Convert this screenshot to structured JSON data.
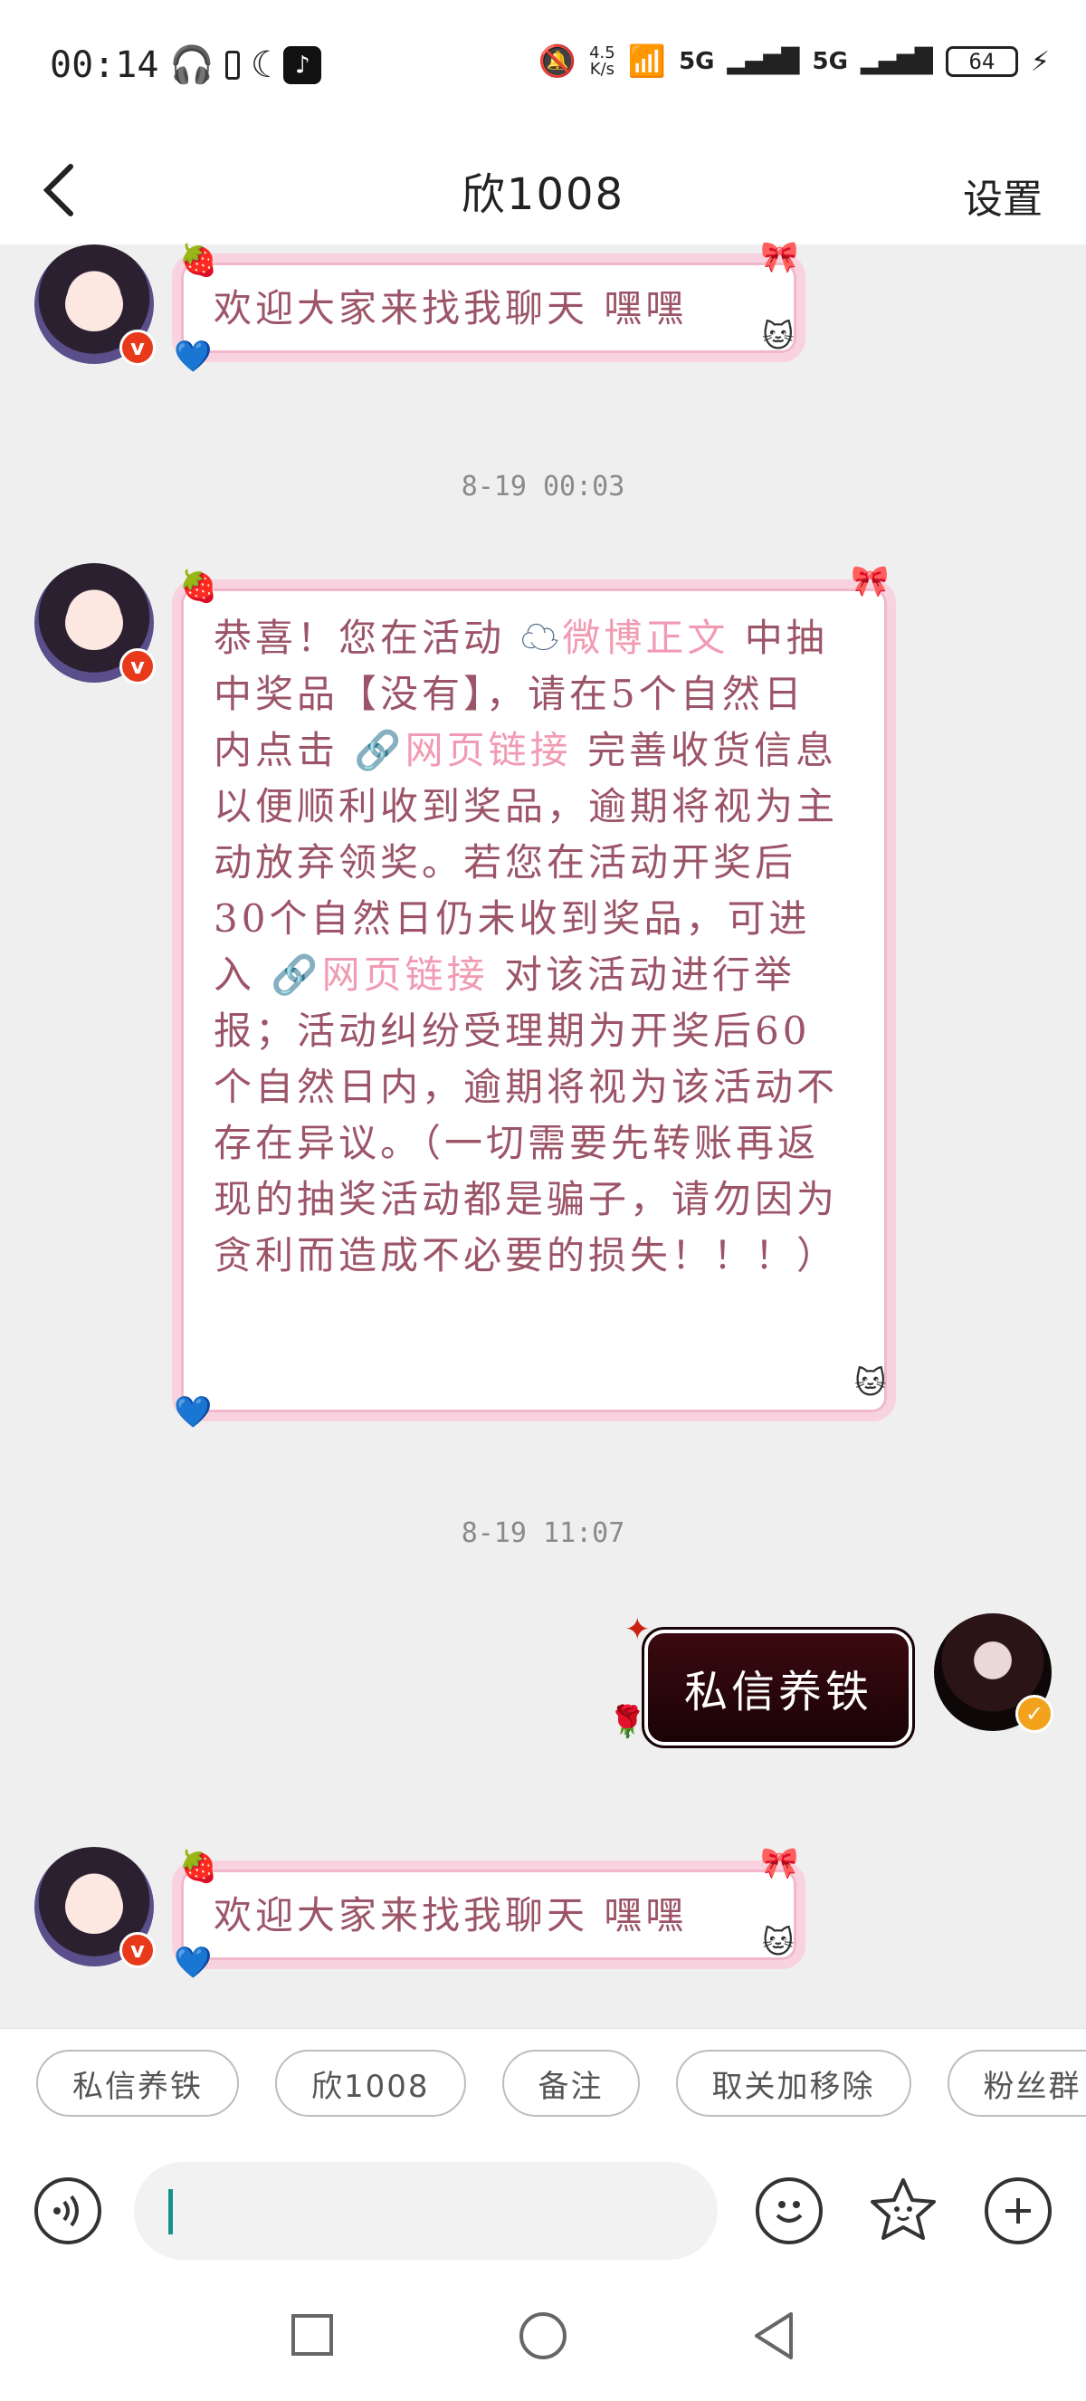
{
  "status": {
    "time": "00:14",
    "net_speed_value": "4.5",
    "net_speed_unit": "K/s",
    "signal1": "5G",
    "signal2": "5G",
    "battery": "64"
  },
  "nav": {
    "title": "欣1008",
    "settings_label": "设置"
  },
  "messages": [
    {
      "text": "欢迎大家来找我聊天 嘿嘿"
    },
    {
      "timestamp": "8-19 00:03",
      "parts": {
        "p1": "恭喜！您在活动",
        "link1": "微博正文",
        "p2": "中抽中奖品【没有】，请在5个自然日内点击",
        "link2": "网页链接",
        "p3": "完善收货信息以便顺利收到奖品，逾期将视为主动放弃领奖。若您在活动开奖后30个自然日仍未收到奖品，可进入",
        "link3": "网页链接",
        "p4": "对该活动进行举报；活动纠纷受理期为开奖后60个自然日内，逾期将视为该活动不存在异议。（一切需要先转账再返现的抽奖活动都是骗子，请勿因为贪利而造成不必要的损失！！！）"
      }
    },
    {
      "timestamp": "8-19 11:07",
      "text": "私信养铁"
    },
    {
      "text": "欢迎大家来找我聊天 嘿嘿"
    }
  ],
  "quick_replies": [
    "私信养铁",
    "欣1008",
    "备注",
    "取关加移除",
    "粉丝群"
  ],
  "input": {
    "value": ""
  },
  "colors": {
    "accent_pink": "#f19ab3",
    "verified_gold": "#f2a21b",
    "dark_bubble": "#3b0a10"
  }
}
